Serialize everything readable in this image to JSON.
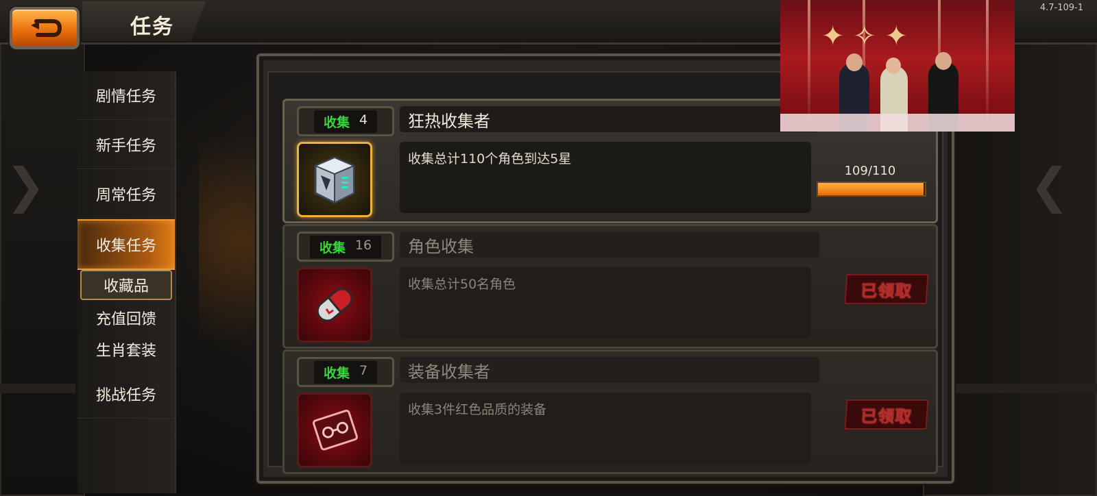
{
  "header": {
    "title": "任务",
    "version_text": "4.7-109-1"
  },
  "sidebar": {
    "items": [
      {
        "label": "剧情任务"
      },
      {
        "label": "新手任务"
      },
      {
        "label": "周常任务"
      },
      {
        "label": "收集任务",
        "active": true
      },
      {
        "label": "收藏品",
        "selected": true
      },
      {
        "label": "充值回馈"
      },
      {
        "label": "生肖套装"
      },
      {
        "label": "挑战任务"
      }
    ]
  },
  "quests": [
    {
      "tag_label": "收集",
      "tag_number": "4",
      "title": "狂热收集者",
      "description": "收集总计110个角色到达5星",
      "icon": "mech-box-icon",
      "progress_text": "109/110",
      "progress_fraction": 0.99
    },
    {
      "tag_label": "收集",
      "tag_number": "16",
      "title": "角色收集",
      "description": "收集总计50名角色",
      "icon": "capsule-icon",
      "status": "已领取"
    },
    {
      "tag_label": "收集",
      "tag_number": "7",
      "title": "装备收集者",
      "description": "收集3件红色品质的装备",
      "icon": "equipment-card-icon",
      "status": "已领取"
    }
  ],
  "colors": {
    "accent_orange": "#e96c0a",
    "tag_green": "#38d63a",
    "claimed_red": "#b32a26"
  }
}
